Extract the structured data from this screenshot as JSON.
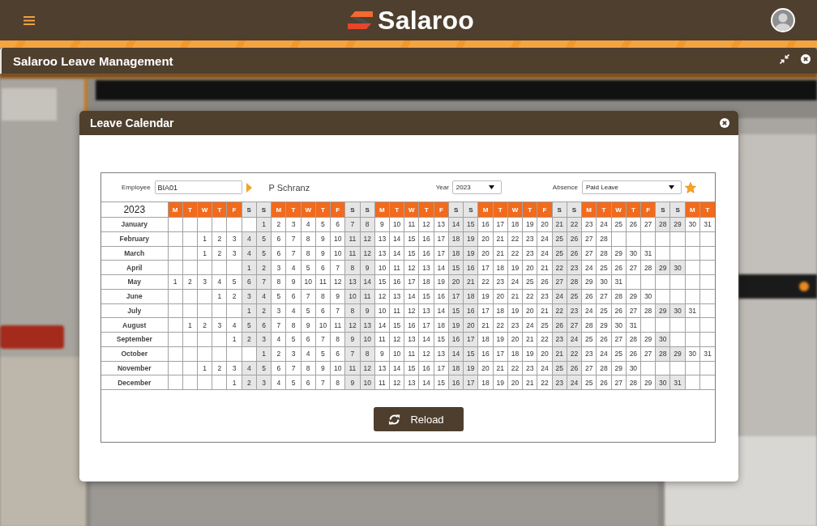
{
  "app_bar": {
    "logo_text": "Salaroo"
  },
  "window": {
    "title": "Salaroo Leave Management"
  },
  "dialog": {
    "title": "Leave Calendar",
    "toolbar": {
      "employee": {
        "label": "Employee",
        "value": "BIA01",
        "name": "P Schranz"
      },
      "year": {
        "label": "Year",
        "value": "2023"
      },
      "absence": {
        "label": "Absence",
        "value": "Paid Leave"
      }
    },
    "calendar": {
      "year": "2023",
      "weekdays": [
        {
          "label": "M",
          "kind": "weekday"
        },
        {
          "label": "T",
          "kind": "weekday"
        },
        {
          "label": "W",
          "kind": "weekday"
        },
        {
          "label": "T",
          "kind": "weekday"
        },
        {
          "label": "F",
          "kind": "weekday"
        },
        {
          "label": "S",
          "kind": "weekend"
        },
        {
          "label": "S",
          "kind": "weekend"
        },
        {
          "label": "M",
          "kind": "weekday"
        },
        {
          "label": "T",
          "kind": "weekday"
        },
        {
          "label": "W",
          "kind": "weekday"
        },
        {
          "label": "T",
          "kind": "weekday"
        },
        {
          "label": "F",
          "kind": "weekday"
        },
        {
          "label": "S",
          "kind": "weekend"
        },
        {
          "label": "S",
          "kind": "weekend"
        },
        {
          "label": "M",
          "kind": "weekday"
        },
        {
          "label": "T",
          "kind": "weekday"
        },
        {
          "label": "W",
          "kind": "weekday"
        },
        {
          "label": "T",
          "kind": "weekday"
        },
        {
          "label": "F",
          "kind": "weekday"
        },
        {
          "label": "S",
          "kind": "weekend"
        },
        {
          "label": "S",
          "kind": "weekend"
        },
        {
          "label": "M",
          "kind": "weekday"
        },
        {
          "label": "T",
          "kind": "weekday"
        },
        {
          "label": "W",
          "kind": "weekday"
        },
        {
          "label": "T",
          "kind": "weekday"
        },
        {
          "label": "F",
          "kind": "weekday"
        },
        {
          "label": "S",
          "kind": "weekend"
        },
        {
          "label": "S",
          "kind": "weekend"
        },
        {
          "label": "M",
          "kind": "weekday"
        },
        {
          "label": "T",
          "kind": "weekday"
        },
        {
          "label": "W",
          "kind": "weekday"
        },
        {
          "label": "T",
          "kind": "weekday"
        },
        {
          "label": "F",
          "kind": "weekday"
        },
        {
          "label": "S",
          "kind": "weekend"
        },
        {
          "label": "S",
          "kind": "weekend"
        },
        {
          "label": "M",
          "kind": "weekday"
        },
        {
          "label": "T",
          "kind": "weekday"
        }
      ],
      "months": [
        {
          "name": "January",
          "days": [
            "1",
            "2",
            "3",
            "4",
            "5",
            "6",
            "7",
            "8",
            "9",
            "10",
            "11",
            "12",
            "13",
            "14",
            "15",
            "16",
            "17",
            "18",
            "19",
            "20",
            "21",
            "22",
            "23",
            "24",
            "25",
            "26",
            "27",
            "28",
            "29",
            "30",
            "31"
          ]
        },
        {
          "name": "February",
          "days": [
            "1",
            "2",
            "3",
            "4",
            "5",
            "6",
            "7",
            "8",
            "9",
            "10",
            "11",
            "12",
            "13",
            "14",
            "15",
            "16",
            "17",
            "18",
            "19",
            "20",
            "21",
            "22",
            "23",
            "24",
            "25",
            "26",
            "27",
            "28"
          ]
        },
        {
          "name": "March",
          "days": [
            "1",
            "2",
            "3",
            "4",
            "5",
            "6",
            "7",
            "8",
            "9",
            "10",
            "11",
            "12",
            "13",
            "14",
            "15",
            "16",
            "17",
            "18",
            "19",
            "20",
            "21",
            "22",
            "23",
            "24",
            "25",
            "26",
            "27",
            "28",
            "29",
            "30",
            "31"
          ]
        },
        {
          "name": "April",
          "days": [
            "1",
            "2",
            "3",
            "4",
            "5",
            "6",
            "7",
            "8",
            "9",
            "10",
            "11",
            "12",
            "13",
            "14",
            "15",
            "16",
            "17",
            "18",
            "19",
            "20",
            "21",
            "22",
            "23",
            "24",
            "25",
            "26",
            "27",
            "28",
            "29",
            "30"
          ]
        },
        {
          "name": "May",
          "days": [
            "1",
            "2",
            "3",
            "4",
            "5",
            "6",
            "7",
            "8",
            "9",
            "10",
            "11",
            "12",
            "13",
            "14",
            "15",
            "16",
            "17",
            "18",
            "19",
            "20",
            "21",
            "22",
            "23",
            "24",
            "25",
            "26",
            "27",
            "28",
            "29",
            "30",
            "31"
          ]
        },
        {
          "name": "June",
          "days": [
            "1",
            "2",
            "3",
            "4",
            "5",
            "6",
            "7",
            "8",
            "9",
            "10",
            "11",
            "12",
            "13",
            "14",
            "15",
            "16",
            "17",
            "18",
            "19",
            "20",
            "21",
            "22",
            "23",
            "24",
            "25",
            "26",
            "27",
            "28",
            "29",
            "30"
          ]
        },
        {
          "name": "July",
          "days": [
            "1",
            "2",
            "3",
            "4",
            "5",
            "6",
            "7",
            "8",
            "9",
            "10",
            "11",
            "12",
            "13",
            "14",
            "15",
            "16",
            "17",
            "18",
            "19",
            "20",
            "21",
            "22",
            "23",
            "24",
            "25",
            "26",
            "27",
            "28",
            "29",
            "30",
            "31"
          ]
        },
        {
          "name": "August",
          "days": [
            "1",
            "2",
            "3",
            "4",
            "5",
            "6",
            "7",
            "8",
            "9",
            "10",
            "11",
            "12",
            "13",
            "14",
            "15",
            "16",
            "17",
            "18",
            "19",
            "20",
            "21",
            "22",
            "23",
            "24",
            "25",
            "26",
            "27",
            "28",
            "29",
            "30",
            "31"
          ]
        },
        {
          "name": "September",
          "days": [
            "1",
            "2",
            "3",
            "4",
            "5",
            "6",
            "7",
            "8",
            "9",
            "10",
            "11",
            "12",
            "13",
            "14",
            "15",
            "16",
            "17",
            "18",
            "19",
            "20",
            "21",
            "22",
            "23",
            "24",
            "25",
            "26",
            "27",
            "28",
            "29",
            "30"
          ]
        },
        {
          "name": "October",
          "days": [
            "1",
            "2",
            "3",
            "4",
            "5",
            "6",
            "7",
            "8",
            "9",
            "10",
            "11",
            "12",
            "13",
            "14",
            "15",
            "16",
            "17",
            "18",
            "19",
            "20",
            "21",
            "22",
            "23",
            "24",
            "25",
            "26",
            "27",
            "28",
            "29",
            "30",
            "31"
          ]
        },
        {
          "name": "November",
          "days": [
            "1",
            "2",
            "3",
            "4",
            "5",
            "6",
            "7",
            "8",
            "9",
            "10",
            "11",
            "12",
            "13",
            "14",
            "15",
            "16",
            "17",
            "18",
            "19",
            "20",
            "21",
            "22",
            "23",
            "24",
            "25",
            "26",
            "27",
            "28",
            "29",
            "30"
          ]
        },
        {
          "name": "December",
          "days": [
            "1",
            "2",
            "3",
            "4",
            "5",
            "6",
            "7",
            "8",
            "9",
            "10",
            "11",
            "12",
            "13",
            "14",
            "15",
            "16",
            "17",
            "18",
            "19",
            "20",
            "21",
            "22",
            "23",
            "24",
            "25",
            "26",
            "27",
            "28",
            "29",
            "30",
            "31"
          ]
        }
      ]
    },
    "reload_button": {
      "label": "Reload"
    }
  }
}
